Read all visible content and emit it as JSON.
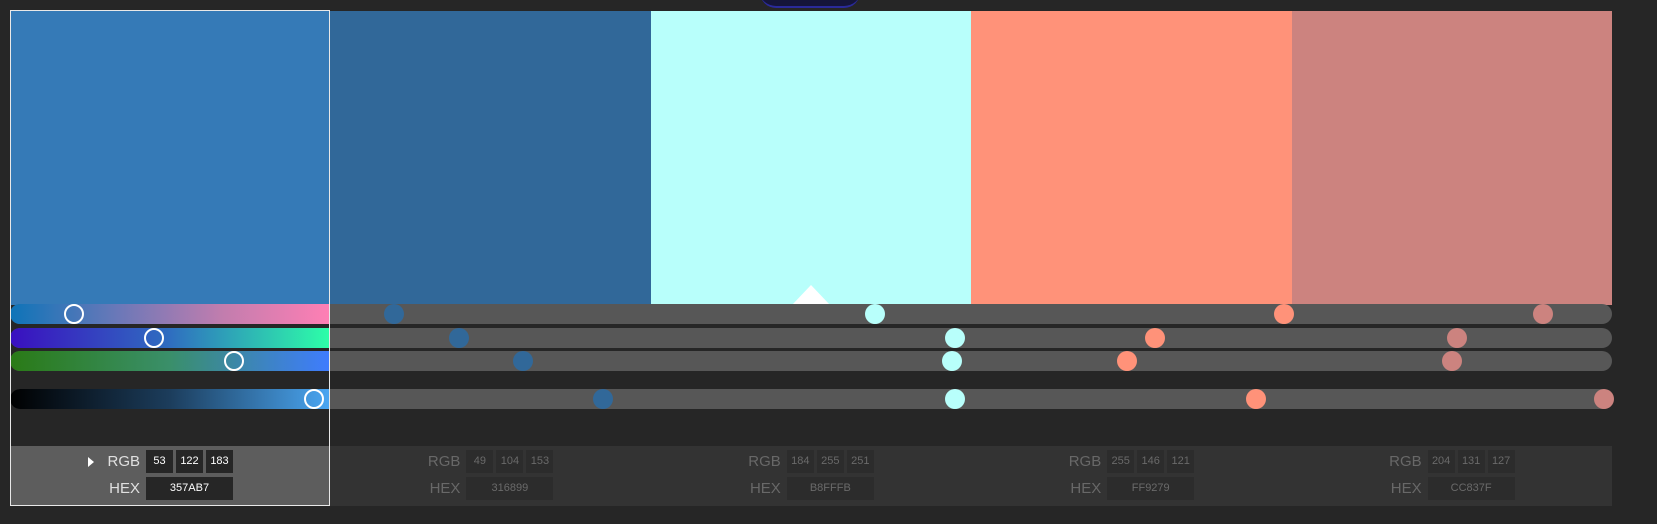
{
  "palette": {
    "active_index": 0,
    "colors": [
      {
        "hex": "#357AB7",
        "r": "53",
        "g": "122",
        "b": "183",
        "hex_label": "357AB7",
        "a": 0.04,
        "b_pos": 0.09,
        "c": 0.14,
        "lum": 0.19
      },
      {
        "hex": "#316899",
        "r": "49",
        "g": "104",
        "b": "153",
        "hex_label": "316899",
        "a": 0.24,
        "b_pos": 0.28,
        "c": 0.32,
        "lum": 0.37
      },
      {
        "hex": "#B8FFFB",
        "r": "184",
        "g": "255",
        "b": "251",
        "hex_label": "B8FFFB",
        "a": 0.54,
        "b_pos": 0.59,
        "c": 0.588,
        "lum": 0.59
      },
      {
        "hex": "#FF9279",
        "r": "255",
        "g": "146",
        "b": "121",
        "hex_label": "FF9279",
        "a": 0.795,
        "b_pos": 0.715,
        "c": 0.697,
        "lum": 0.778
      },
      {
        "hex": "#CC837F",
        "r": "204",
        "g": "131",
        "b": "127",
        "hex_label": "CC837F",
        "a": 0.957,
        "b_pos": 0.903,
        "c": 0.9,
        "lum": 0.995
      }
    ]
  },
  "slider_gradients": {
    "hue": [
      "#0d74b8",
      "#6a78b8",
      "#c27dae",
      "#ff7fb4"
    ],
    "channel2": [
      "#3a0fc0",
      "#2f6ec0",
      "#2dffa8"
    ],
    "channel3": [
      "#2a7a16",
      "#3a8f6a",
      "#3f7cff"
    ],
    "luminance": [
      "#000000",
      "#1c3d5c",
      "#4aa6f2"
    ]
  },
  "labels": {
    "rgb": "RGB",
    "hex": "HEX"
  }
}
